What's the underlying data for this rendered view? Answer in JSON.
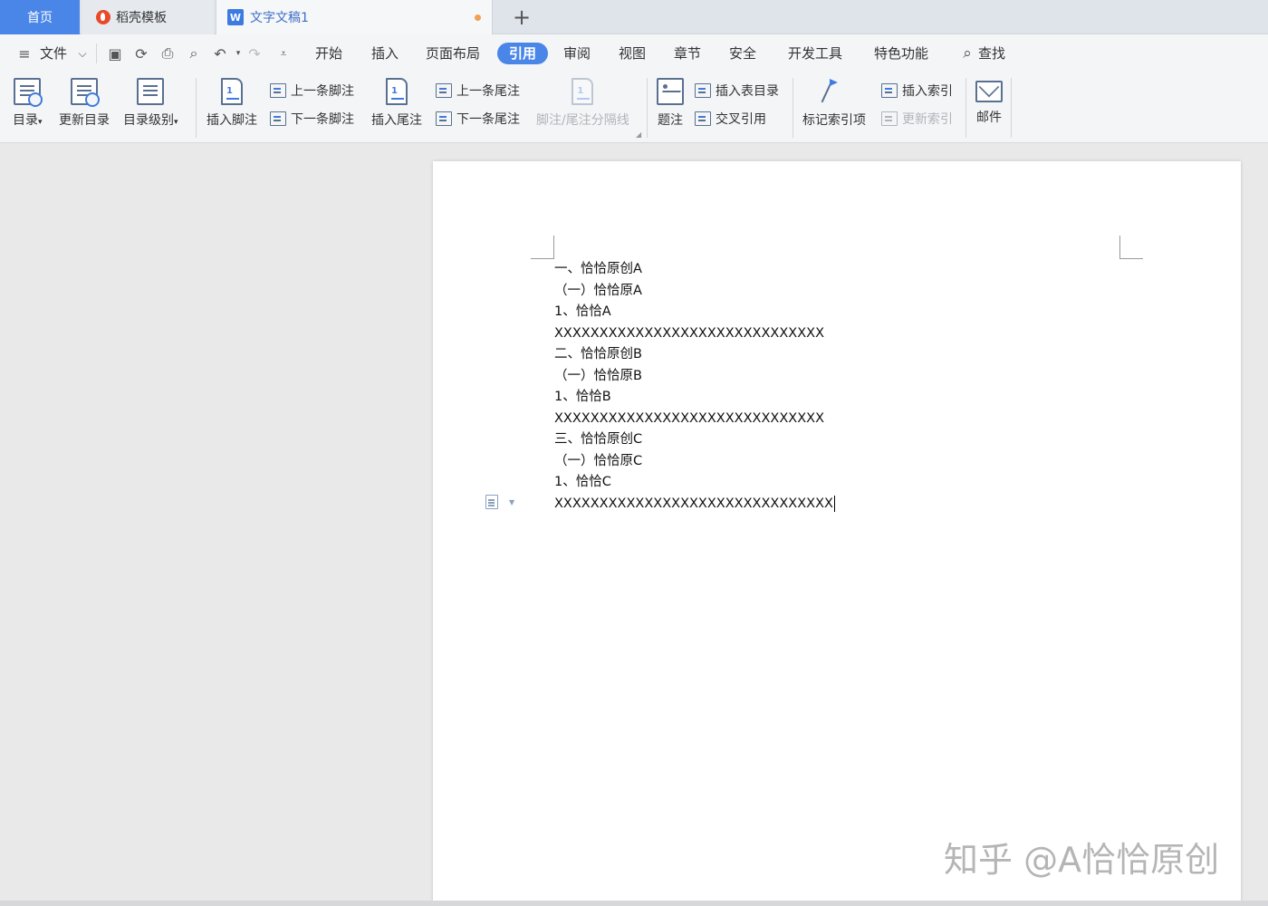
{
  "tabs": {
    "home": "首页",
    "template": "稻壳模板",
    "document": "文字文稿1",
    "doc_icon": "W"
  },
  "menu": {
    "file": "文件",
    "items": [
      "开始",
      "插入",
      "页面布局",
      "引用",
      "审阅",
      "视图",
      "章节",
      "安全",
      "开发工具",
      "特色功能"
    ],
    "active": "引用",
    "search": "查找"
  },
  "ribbon": {
    "toc": "目录",
    "update_toc": "更新目录",
    "toc_level": "目录级别",
    "insert_footnote": "插入脚注",
    "prev_footnote": "上一条脚注",
    "next_footnote": "下一条脚注",
    "insert_endnote": "插入尾注",
    "prev_endnote": "上一条尾注",
    "next_endnote": "下一条尾注",
    "separator": "脚注/尾注分隔线",
    "caption": "题注",
    "insert_table_of_figures": "插入表目录",
    "cross_reference": "交叉引用",
    "mark_index_entry": "标记索引项",
    "insert_index": "插入索引",
    "update_index": "更新索引",
    "mail": "邮件"
  },
  "document": {
    "lines": [
      "一、恰恰原创A",
      "（一）恰恰原A",
      "1、恰恰A",
      "XXXXXXXXXXXXXXXXXXXXXXXXXXXXXX",
      "二、恰恰原创B",
      "（一）恰恰原B",
      "1、恰恰B",
      "XXXXXXXXXXXXXXXXXXXXXXXXXXXXXX",
      "三、恰恰原创C",
      "（一）恰恰原C",
      "1、恰恰C",
      "XXXXXXXXXXXXXXXXXXXXXXXXXXXXXXX"
    ]
  },
  "watermark": "知乎 @A恰恰原创",
  "colors": {
    "accent": "#4a86e8",
    "unsaved_dot": "#f0a050"
  }
}
